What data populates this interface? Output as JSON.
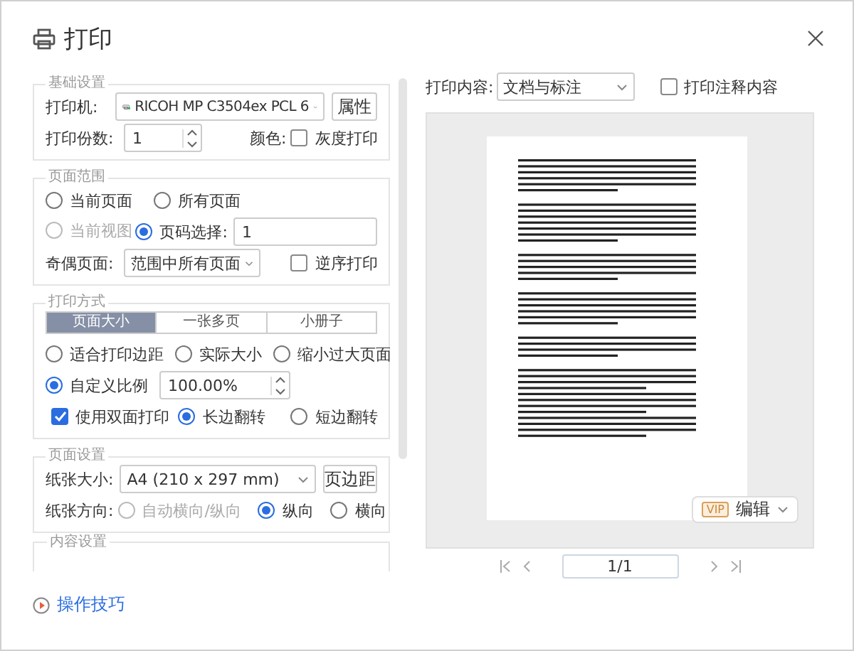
{
  "window": {
    "title": "打印"
  },
  "basic": {
    "legend": "基础设置",
    "printer_label": "打印机:",
    "printer": "RICOH MP C3504ex PCL 6",
    "properties_button": "属性",
    "copies_label": "打印份数:",
    "copies": "1",
    "color_label": "颜色:",
    "grayscale": {
      "label": "灰度打印",
      "checked": false
    }
  },
  "page_range": {
    "legend": "页面范围",
    "options": [
      {
        "label": "当前页面",
        "selected": false,
        "disabled": false
      },
      {
        "label": "所有页面",
        "selected": false,
        "disabled": false
      },
      {
        "label": "当前视图",
        "selected": false,
        "disabled": true
      },
      {
        "label": "页码选择:",
        "selected": true,
        "disabled": false
      }
    ],
    "pages_value": "1",
    "odd_even_label": "奇偶页面:",
    "odd_even": "范围中所有页面",
    "reverse": {
      "label": "逆序打印",
      "checked": false
    }
  },
  "print_mode": {
    "legend": "打印方式",
    "tabs": [
      {
        "label": "页面大小",
        "selected": true
      },
      {
        "label": "一张多页",
        "selected": false
      },
      {
        "label": "小册子",
        "selected": false
      }
    ],
    "scale_options": [
      {
        "label": "适合打印边距",
        "selected": false,
        "disabled": false
      },
      {
        "label": "实际大小",
        "selected": false,
        "disabled": false
      },
      {
        "label": "缩小过大页面",
        "selected": false,
        "disabled": false
      },
      {
        "label": "自定义比例",
        "selected": true,
        "disabled": false
      }
    ],
    "scale_value": "100.00%",
    "duplex": {
      "label": "使用双面打印",
      "checked": true
    },
    "flip_options": [
      {
        "label": "长边翻转",
        "selected": true,
        "disabled": false
      },
      {
        "label": "短边翻转",
        "selected": false,
        "disabled": false
      }
    ]
  },
  "page_setup": {
    "legend": "页面设置",
    "paper_label": "纸张大小:",
    "paper": "A4 (210 x 297 mm)",
    "margins_button": "页边距",
    "orientation_label": "纸张方向:",
    "orientations": [
      {
        "label": "自动横向/纵向",
        "selected": false,
        "disabled": true
      },
      {
        "label": "纵向",
        "selected": true,
        "disabled": false
      },
      {
        "label": "横向",
        "selected": false,
        "disabled": false
      }
    ]
  },
  "content_setup": {
    "legend": "内容设置"
  },
  "tips_link": "操作技巧",
  "preview": {
    "content_label": "打印内容:",
    "content": "文档与标注",
    "annotations": {
      "label": "打印注释内容",
      "checked": false
    },
    "edit_badge": "VIP",
    "edit_button": "编辑",
    "page_indicator": "1/1"
  }
}
